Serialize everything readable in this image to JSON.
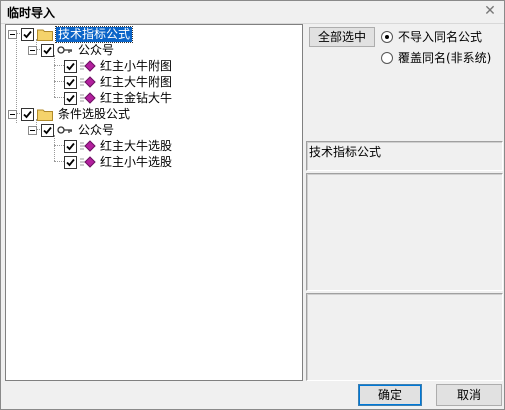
{
  "window": {
    "title": "临时导入",
    "close_glyph": "✕"
  },
  "tree": {
    "groups": [
      {
        "label": "技术指标公式",
        "checked": true,
        "selected": true,
        "sub": {
          "label": "公众号",
          "checked": true,
          "items": [
            {
              "label": "红主小牛附图",
              "checked": true
            },
            {
              "label": "红主大牛附图",
              "checked": true
            },
            {
              "label": "红主金钻大牛",
              "checked": true
            }
          ]
        }
      },
      {
        "label": "条件选股公式",
        "checked": true,
        "selected": false,
        "sub": {
          "label": "公众号",
          "checked": true,
          "items": [
            {
              "label": "红主大牛选股",
              "checked": true
            },
            {
              "label": "红主小牛选股",
              "checked": true
            }
          ]
        }
      }
    ]
  },
  "right": {
    "select_all_label": "全部选中",
    "radio_options": [
      {
        "label": "不导入同名公式",
        "selected": true
      },
      {
        "label": "覆盖同名(非系统)",
        "selected": false
      }
    ],
    "info_text": "技术指标公式"
  },
  "footer": {
    "ok_label": "确定",
    "cancel_label": "取消"
  },
  "colors": {
    "selection": "#0a64c8",
    "diamond": "#b3209e",
    "folder": "#f5d36b"
  }
}
